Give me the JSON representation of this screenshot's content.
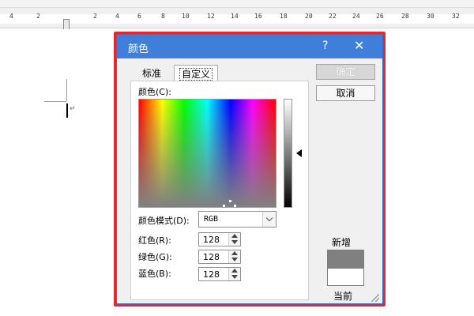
{
  "background": {
    "ruler_labels": [
      "4",
      "2",
      "2",
      "4",
      "6",
      "8",
      "10",
      "12",
      "14",
      "16",
      "18",
      "20",
      "22",
      "24",
      "26",
      "28",
      "30",
      "32"
    ]
  },
  "dialog": {
    "title": "颜色",
    "help_glyph": "?",
    "close_glyph": "✕",
    "tabs": [
      {
        "label": "标准"
      },
      {
        "label": "自定义"
      }
    ],
    "color_label": "颜色(C):",
    "color_model": {
      "label": "颜色模式(D):",
      "value": "RGB"
    },
    "channels": [
      {
        "label": "红色(R):",
        "value": "128"
      },
      {
        "label": "绿色(G):",
        "value": "128"
      },
      {
        "label": "蓝色(B):",
        "value": "128"
      }
    ],
    "ok_label": "确定",
    "cancel_label": "取消",
    "new_label": "新增",
    "current_label": "当前",
    "new_color": "#808080",
    "current_color": "#ffffff",
    "accent_color": "#3f7fd9",
    "highlight_color": "#e8262b"
  }
}
